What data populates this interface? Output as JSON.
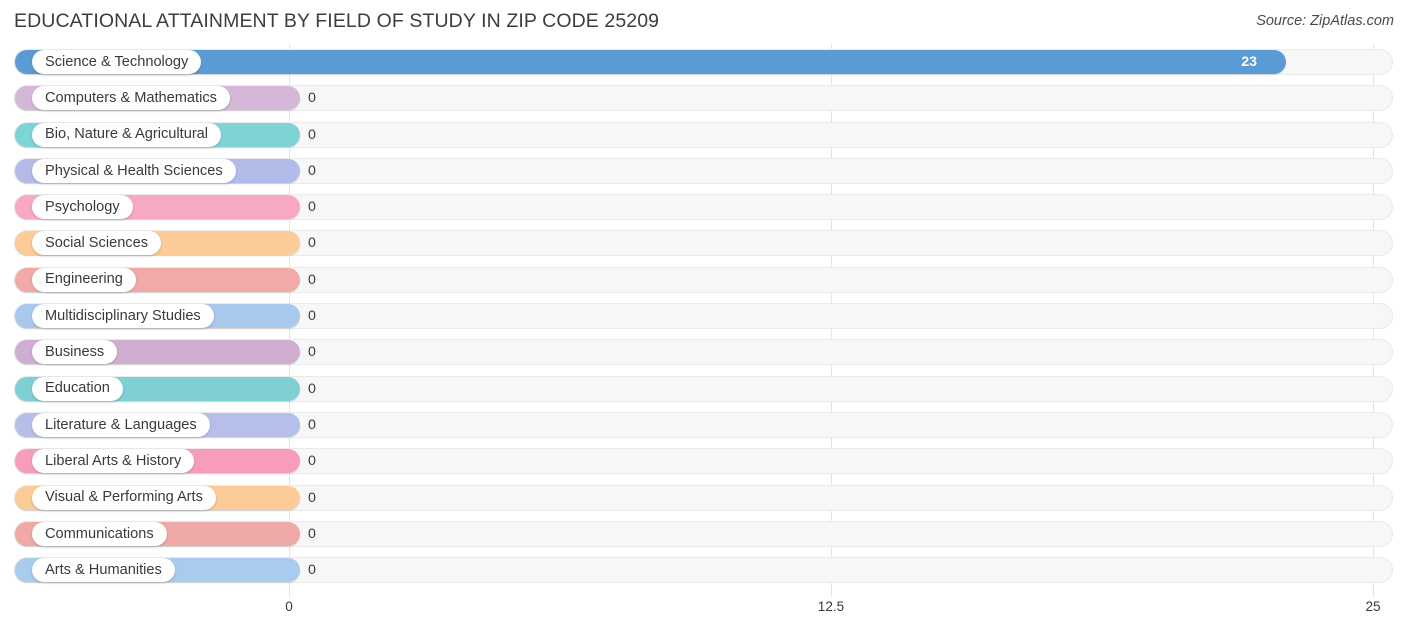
{
  "header": {
    "title": "EDUCATIONAL ATTAINMENT BY FIELD OF STUDY IN ZIP CODE 25209",
    "source": "Source: ZipAtlas.com"
  },
  "chart_data": {
    "type": "bar",
    "orientation": "horizontal",
    "title": "EDUCATIONAL ATTAINMENT BY FIELD OF STUDY IN ZIP CODE 25209",
    "xlabel": "",
    "ylabel": "",
    "xlim": [
      0,
      25
    ],
    "xticks": [
      "0",
      "12.5",
      "25"
    ],
    "xtick_values": [
      0,
      12.5,
      25
    ],
    "grid": true,
    "legend": "none",
    "categories": [
      "Science & Technology",
      "Computers & Mathematics",
      "Bio, Nature & Agricultural",
      "Physical & Health Sciences",
      "Psychology",
      "Social Sciences",
      "Engineering",
      "Multidisciplinary Studies",
      "Business",
      "Education",
      "Literature & Languages",
      "Liberal Arts & History",
      "Visual & Performing Arts",
      "Communications",
      "Arts & Humanities"
    ],
    "values": [
      23,
      0,
      0,
      0,
      0,
      0,
      0,
      0,
      0,
      0,
      0,
      0,
      0,
      0,
      0
    ],
    "value_labels": [
      "23",
      "0",
      "0",
      "0",
      "0",
      "0",
      "0",
      "0",
      "0",
      "0",
      "0",
      "0",
      "0",
      "0",
      "0"
    ],
    "colors": [
      "#5b9bd5",
      "#d5b8d8",
      "#7ed4d5",
      "#b3bce8",
      "#f9a8c2",
      "#fbcb98",
      "#f2aaa8",
      "#a8c8ec",
      "#cfaed2",
      "#7ed0d2",
      "#b6bfe9",
      "#f79cba",
      "#fbcb98",
      "#efa9a7",
      "#a9cbee"
    ]
  },
  "rows": [
    {
      "label": "Science & Technology",
      "value": 23,
      "value_label": "23",
      "color": "#5b9bd5",
      "inside": true
    },
    {
      "label": "Computers & Mathematics",
      "value": 0,
      "value_label": "0",
      "color": "#d5b8d8",
      "inside": false
    },
    {
      "label": "Bio, Nature & Agricultural",
      "value": 0,
      "value_label": "0",
      "color": "#7ed4d5",
      "inside": false
    },
    {
      "label": "Physical & Health Sciences",
      "value": 0,
      "value_label": "0",
      "color": "#b3bce8",
      "inside": false
    },
    {
      "label": "Psychology",
      "value": 0,
      "value_label": "0",
      "color": "#f9a8c2",
      "inside": false
    },
    {
      "label": "Social Sciences",
      "value": 0,
      "value_label": "0",
      "color": "#fbcb98",
      "inside": false
    },
    {
      "label": "Engineering",
      "value": 0,
      "value_label": "0",
      "color": "#f2aaa8",
      "inside": false
    },
    {
      "label": "Multidisciplinary Studies",
      "value": 0,
      "value_label": "0",
      "color": "#a8c8ec",
      "inside": false
    },
    {
      "label": "Business",
      "value": 0,
      "value_label": "0",
      "color": "#cfaed2",
      "inside": false
    },
    {
      "label": "Education",
      "value": 0,
      "value_label": "0",
      "color": "#7ed0d2",
      "inside": false
    },
    {
      "label": "Literature & Languages",
      "value": 0,
      "value_label": "0",
      "color": "#b6bfe9",
      "inside": false
    },
    {
      "label": "Liberal Arts & History",
      "value": 0,
      "value_label": "0",
      "color": "#f79cba",
      "inside": false
    },
    {
      "label": "Visual & Performing Arts",
      "value": 0,
      "value_label": "0",
      "color": "#fbcb98",
      "inside": false
    },
    {
      "label": "Communications",
      "value": 0,
      "value_label": "0",
      "color": "#efa9a7",
      "inside": false
    },
    {
      "label": "Arts & Humanities",
      "value": 0,
      "value_label": "0",
      "color": "#a9cbee",
      "inside": false
    }
  ],
  "axis": {
    "ticks": [
      {
        "label": "0",
        "value": 0
      },
      {
        "label": "12.5",
        "value": 12.5
      },
      {
        "label": "25",
        "value": 25
      }
    ]
  }
}
